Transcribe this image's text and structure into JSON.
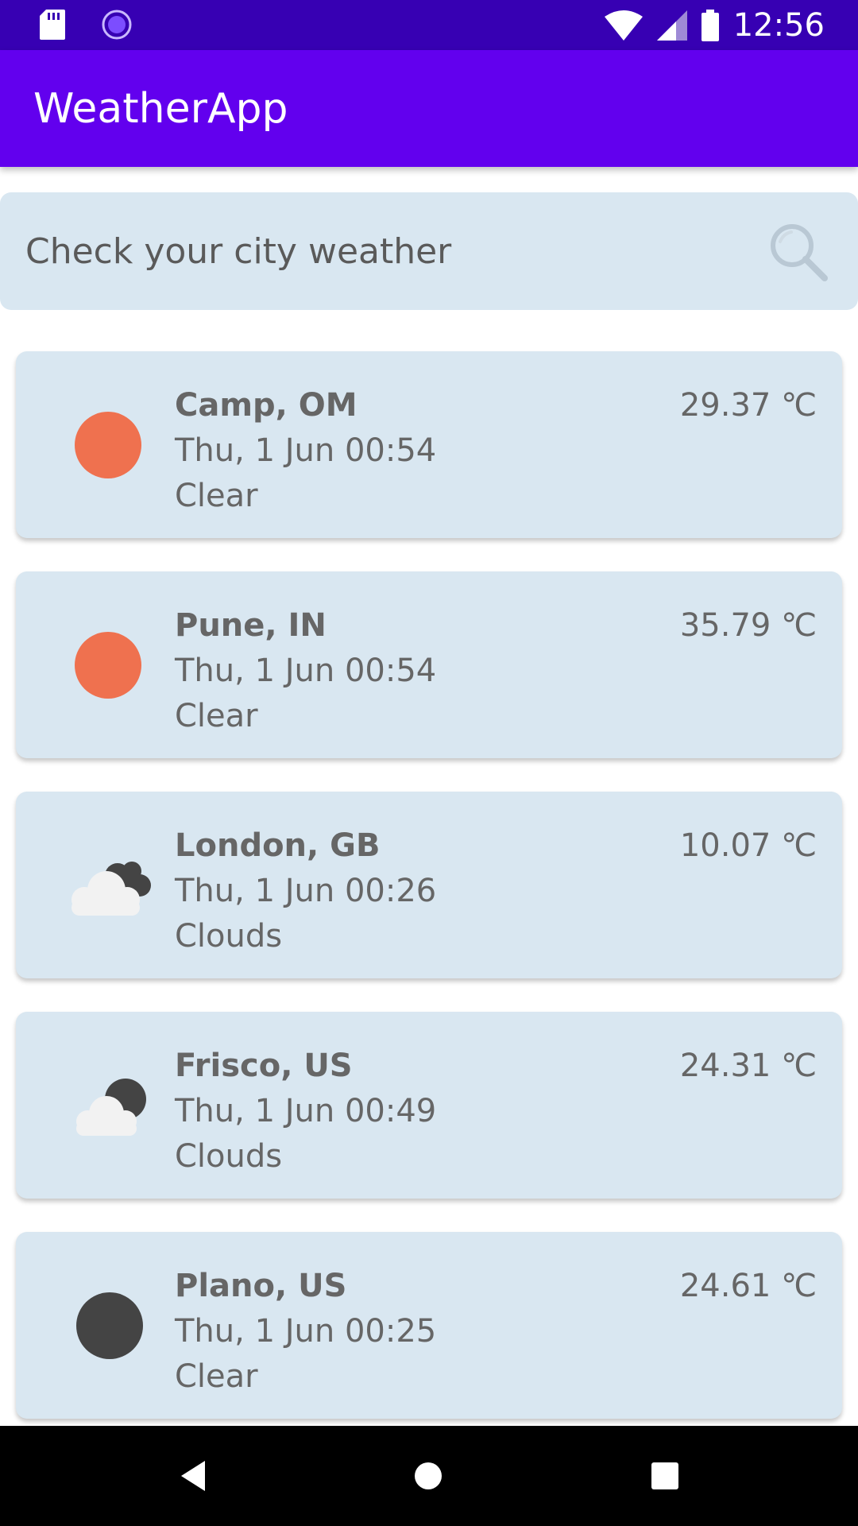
{
  "status_bar": {
    "time": "12:56",
    "icons": [
      "sd-card-icon",
      "sync-icon",
      "wifi-icon",
      "signal-icon",
      "battery-icon"
    ]
  },
  "app_bar": {
    "title": "WeatherApp"
  },
  "search": {
    "placeholder": "Check your city weather",
    "value": "",
    "icon": "search-icon"
  },
  "cities": [
    {
      "name": "Camp, OM",
      "datetime": "Thu, 1 Jun 00:54",
      "condition": "Clear",
      "temperature": "29.37 ℃",
      "icon": "sun-icon",
      "icon_color": "#ef714f"
    },
    {
      "name": "Pune, IN",
      "datetime": "Thu, 1 Jun 00:54",
      "condition": "Clear",
      "temperature": "35.79 ℃",
      "icon": "sun-icon",
      "icon_color": "#ef714f"
    },
    {
      "name": "London, GB",
      "datetime": "Thu, 1 Jun 00:26",
      "condition": "Clouds",
      "temperature": "10.07 ℃",
      "icon": "clouds-icon",
      "icon_color": "#444444"
    },
    {
      "name": "Frisco, US",
      "datetime": "Thu, 1 Jun 00:49",
      "condition": "Clouds",
      "temperature": "24.31 ℃",
      "icon": "cloudy-night-icon",
      "icon_color": "#444444"
    },
    {
      "name": "Plano, US",
      "datetime": "Thu, 1 Jun 00:25",
      "condition": "Clear",
      "temperature": "24.61 ℃",
      "icon": "moon-icon",
      "icon_color": "#444444"
    }
  ],
  "colors": {
    "status_bar": "#3700b3",
    "app_bar": "#6200ee",
    "card_background": "#d9e7f1",
    "text": "#666666"
  },
  "nav_bar": {
    "buttons": [
      "back-icon",
      "home-icon",
      "recents-icon"
    ]
  }
}
